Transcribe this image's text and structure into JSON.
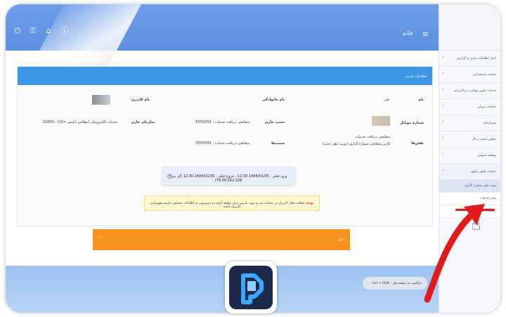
{
  "header": {
    "home_label": "خانه",
    "menu_icon": "hamburger-icon",
    "left_icons": [
      "power-icon",
      "key-icon",
      "home-icon",
      "info-icon"
    ]
  },
  "sidebar": {
    "items": [
      {
        "label": "اخبار اطلاعات فردی و گزارش",
        "chevron": "˅"
      },
      {
        "label": "خدمات استخدامی",
        "chevron": "˅"
      },
      {
        "label": "خدمات پلیس مهاجرت و گذرنامه",
        "chevron": "˅"
      },
      {
        "label": "خدمات میراثی",
        "chevron": "˅"
      },
      {
        "label": "سربازخانه",
        "chevron": "˅"
      },
      {
        "label": "معاون امنیت و کار",
        "chevron": "˅"
      },
      {
        "label": "وظیفه عمومی",
        "chevron": "˅"
      },
      {
        "label": "خدمات پلیس راهور",
        "chevron": "˄"
      },
      {
        "label": "نوبت دهی شماره گذاری",
        "chevron": ""
      },
      {
        "label": "سایر خدمات",
        "chevron": ""
      },
      {
        "label": "ارتباط با ما",
        "chevron": ""
      }
    ]
  },
  "panel": {
    "title": "اطلاعات فردی",
    "name_label": "نام",
    "name_value": "علی",
    "family_label": "نام خانوادگی",
    "username_label": "نام کاربری",
    "mobile_label": "شماره موبایل",
    "current_post_label": "سمت جاری",
    "current_post_value": "5555555 : متقاضی دریافت خدمات",
    "org_label": "سازمان جاری",
    "org_value": "02000 : خدمات الکترونیکی انتظامی (پلیس +10)",
    "roles_label": "نقش‌ها",
    "roles_value_1": "متقاضی دریافت خدمات",
    "roles_value_2": "کاربر متقاضی شماره گذاری (نوبت دهی جدید)",
    "posts_label": "سمت‌ها",
    "posts_value": "5555555 : متقاضی دریافت خدمات",
    "login_info": "ورود قبلی : 1404/01/05 12:30 ، خروج قبلی : 1404/01/05 12:30 (آی پی : 78.39.162.228)",
    "note_prefix": "توجه:",
    "note_text": "فعالیت های کاربران در سامانه ثبت و مورد بازبینی قرار خواهد گرفت و دسترسی به اطلاعات حساس نیازمند هوشیاری کاربران است"
  },
  "announcement": {
    "label": "اخبار",
    "chevron": "˅"
  },
  "footer": {
    "back_hint": "Ctrl + Shift : بازگشت به صفحه قبل"
  },
  "colors": {
    "header_blue": "#5b8fe0",
    "panel_header": "#3d97e8",
    "announce_orange": "#f7941d",
    "note_bg": "#fff7cf",
    "annotation_red": "#e01b1b"
  }
}
